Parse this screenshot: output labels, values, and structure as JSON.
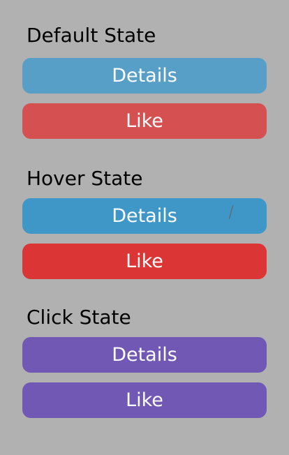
{
  "colors": {
    "background": "#b1b1b1",
    "details_default": "#589fc8",
    "like_default": "#d45051",
    "details_hover": "#3f97c8",
    "like_hover": "#dc3535",
    "click": "#7158b5",
    "text": "#ffffff"
  },
  "sections": [
    {
      "heading": "Default State",
      "details_label": "Details",
      "like_label": "Like"
    },
    {
      "heading": "Hover State",
      "details_label": "Details",
      "like_label": "Like"
    },
    {
      "heading": "Click State",
      "details_label": "Details",
      "like_label": "Like"
    }
  ],
  "icons": {
    "hover_cursor": "cursor-icon"
  }
}
